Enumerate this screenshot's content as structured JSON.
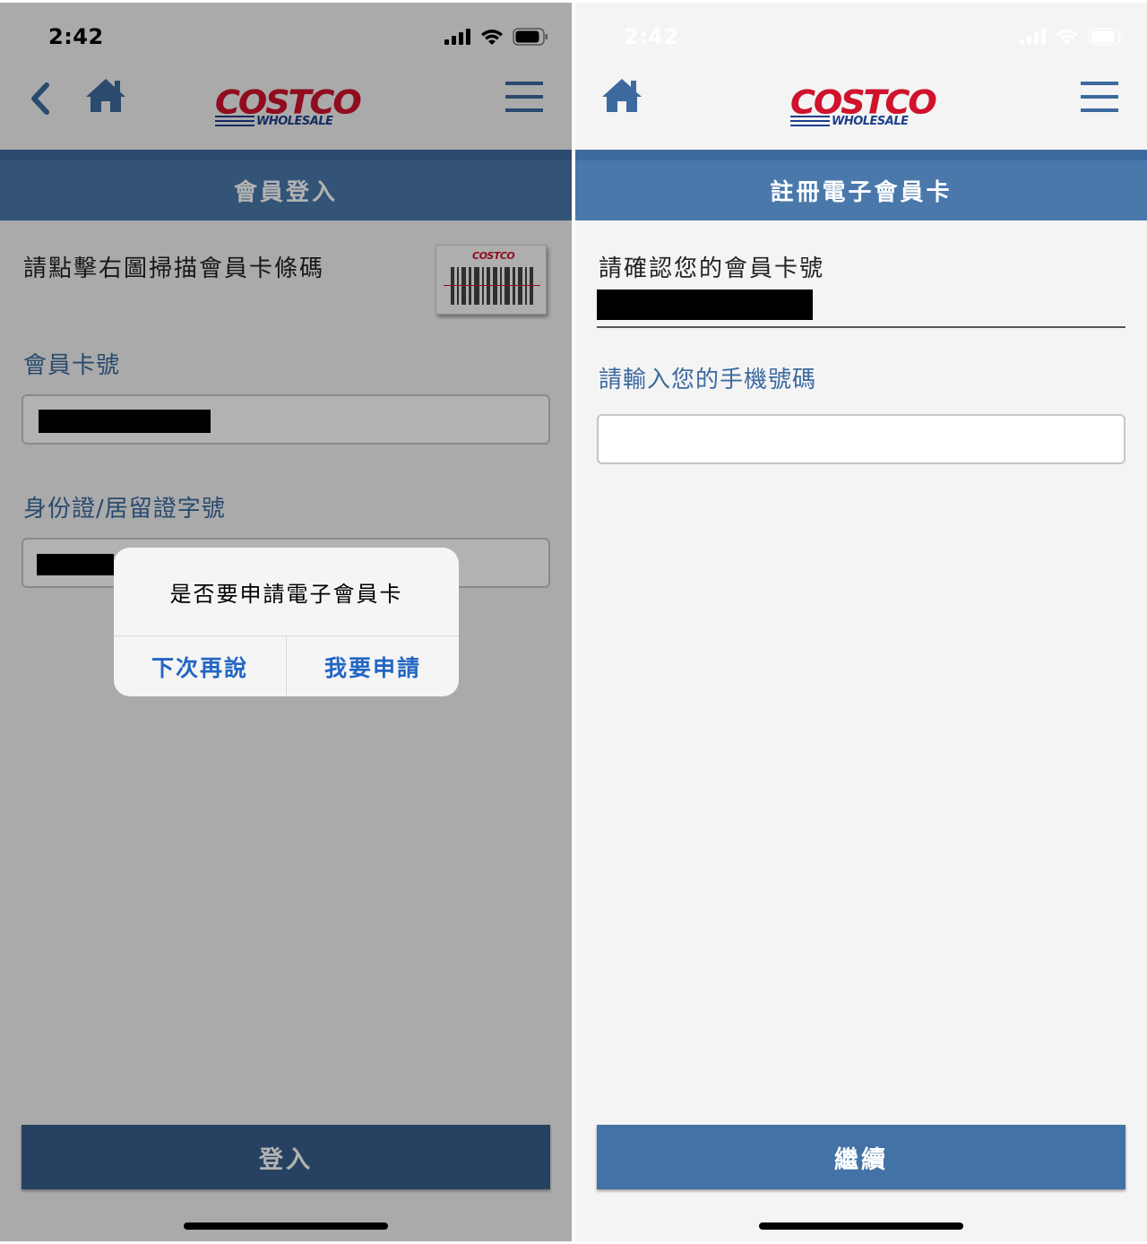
{
  "status_bar": {
    "time": "2:42"
  },
  "colors": {
    "brand_blue": "#4a78ab",
    "brand_red": "#d0122c",
    "link_blue": "#2266c4"
  },
  "logo": {
    "brand": "COSTCO",
    "tagline": "WHOLESALE"
  },
  "left_screen": {
    "title": "會員登入",
    "scan_hint": "請點擊右圖掃描會員卡條碼",
    "barcode_card_logo": "COSTCO",
    "card_number_label": "會員卡號",
    "id_label": "身份證/居留證字號",
    "login_button": "登入",
    "alert": {
      "message": "是否要申請電子會員卡",
      "later_button": "下次再說",
      "apply_button": "我要申請"
    },
    "icons": [
      "back-icon",
      "home-icon",
      "menu-icon",
      "barcode-icon"
    ]
  },
  "right_screen": {
    "title": "註冊電子會員卡",
    "confirm_label": "請確認您的會員卡號",
    "phone_label": "請輸入您的手機號碼",
    "phone_input_value": "",
    "continue_button": "繼續",
    "icons": [
      "home-icon",
      "menu-icon"
    ]
  }
}
